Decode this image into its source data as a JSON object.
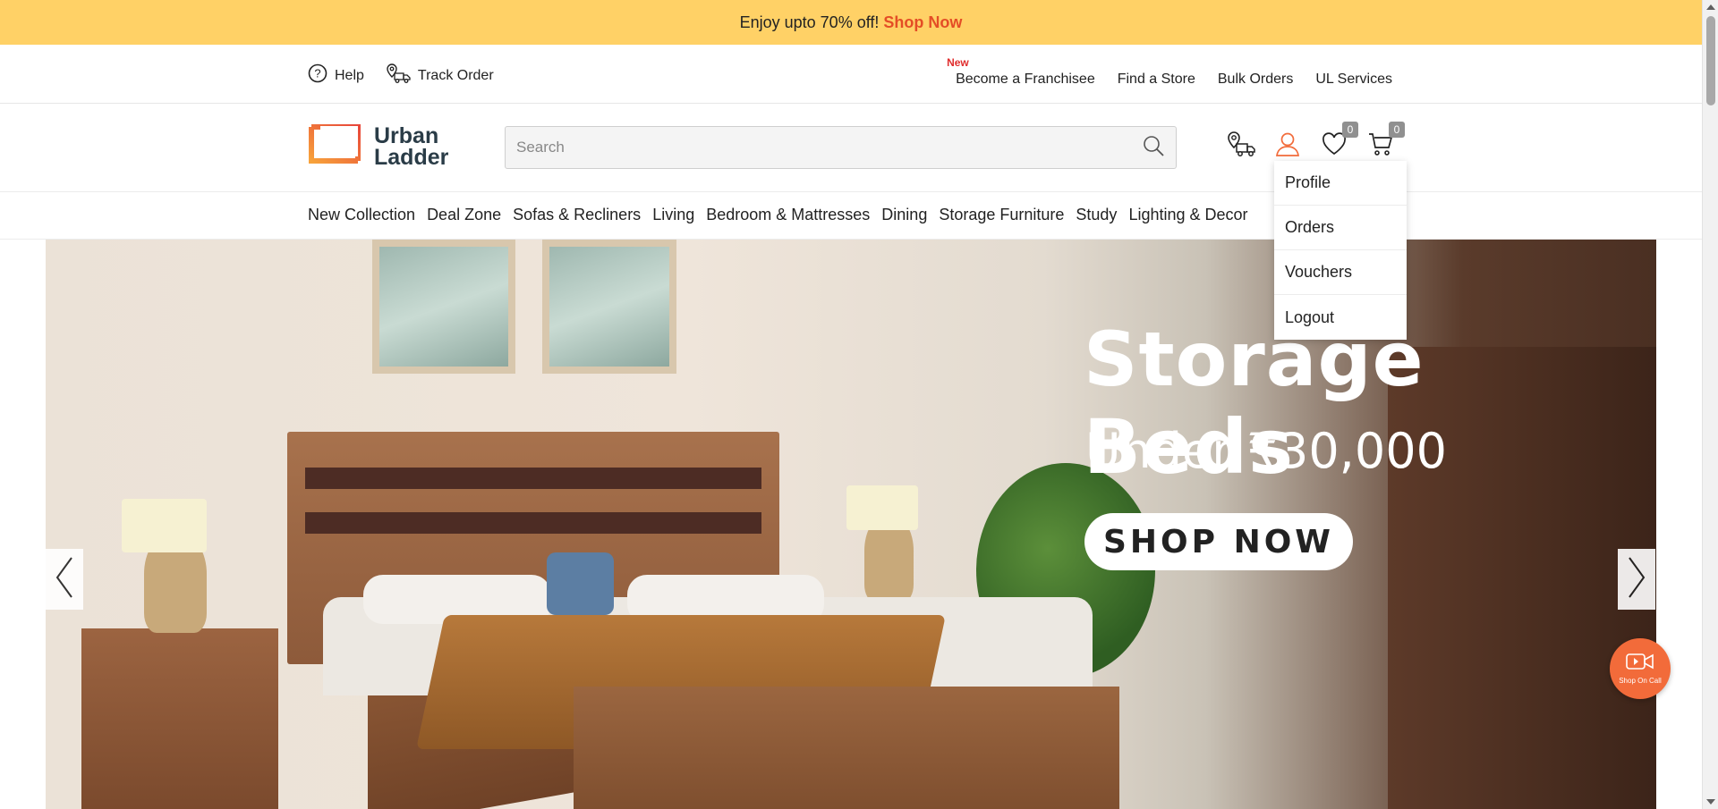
{
  "promo": {
    "text": "Enjoy upto 70% off!",
    "link": "Shop Now"
  },
  "utility": {
    "help": "Help",
    "track_order": "Track Order",
    "new_tag": "New",
    "links": [
      "Become a Franchisee",
      "Find a Store",
      "Bulk Orders",
      "UL Services"
    ]
  },
  "header": {
    "logo_line1": "Urban",
    "logo_line2": "Ladder",
    "search_placeholder": "Search",
    "wishlist_count": "0",
    "cart_count": "0"
  },
  "categories": [
    "New Collection",
    "Deal Zone",
    "Sofas & Recliners",
    "Living",
    "Bedroom & Mattresses",
    "Dining",
    "Storage Furniture",
    "Study",
    "Lighting & Decor"
  ],
  "account_menu": [
    "Profile",
    "Orders",
    "Vouchers",
    "Logout"
  ],
  "banner": {
    "headline": "Storage Beds",
    "subhead": "Under ₹30,000",
    "cta": "SHOP NOW"
  },
  "floating": {
    "shop_on_call": "Shop On Call"
  },
  "colors": {
    "promo_bg": "#ffd166",
    "accent": "#e44d26",
    "logo_orange": "#f26b3a",
    "logo_text": "#2a3c47"
  }
}
